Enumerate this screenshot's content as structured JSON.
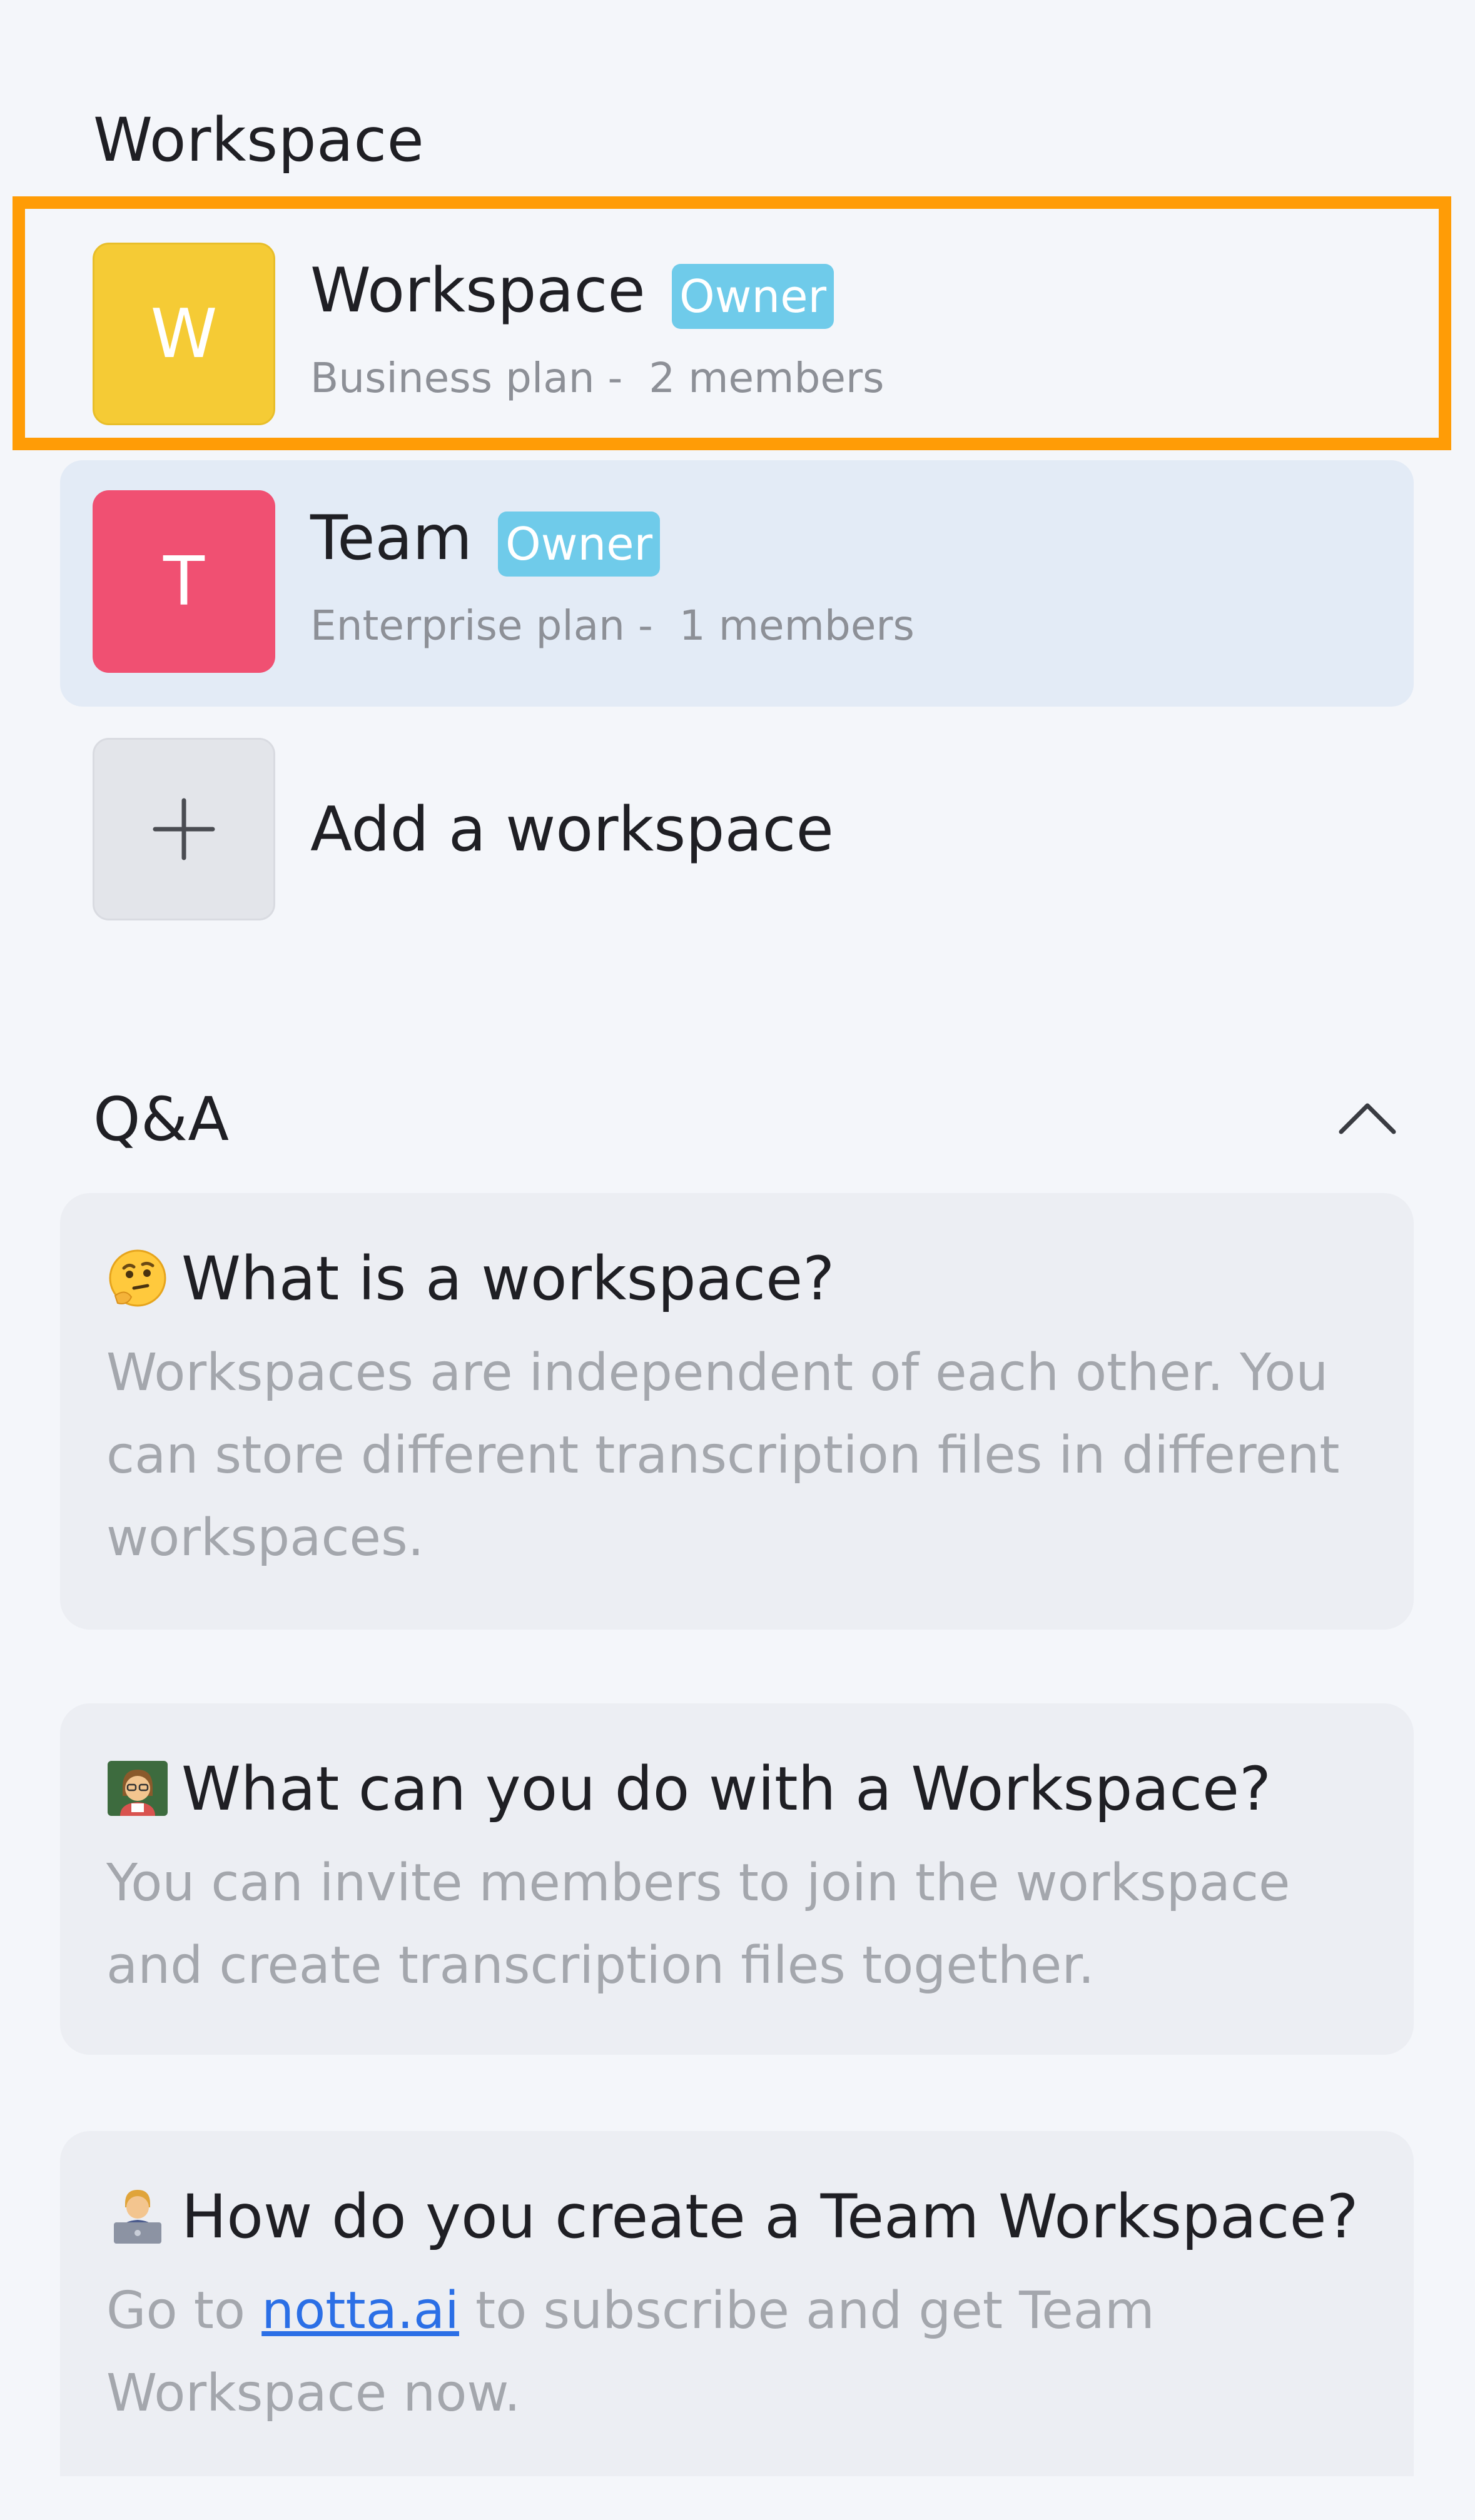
{
  "workspace_section": {
    "title": "Workspace",
    "items": [
      {
        "initial": "W",
        "name": "Workspace",
        "role": "Owner",
        "plan": "Business plan -",
        "members": "2 members",
        "avatar_color": "#F5CB35",
        "highlighted": true
      },
      {
        "initial": "T",
        "name": "Team",
        "role": "Owner",
        "plan": "Enterprise plan -",
        "members": "1 members",
        "avatar_color": "#F05072",
        "selected": true
      }
    ],
    "add_label": "Add a workspace"
  },
  "qa_section": {
    "title": "Q&A",
    "expanded": true,
    "items": [
      {
        "icon": "thinking-face-icon",
        "question": "What is a workspace?",
        "answer": "Workspaces are independent of each other. You can store different transcription files in different workspaces."
      },
      {
        "icon": "teacher-icon",
        "question": "What can you do with a Workspace?",
        "answer": "You can invite members to join the workspace and create transcription files together."
      },
      {
        "icon": "technologist-icon",
        "question": "How do you create a Team Workspace?",
        "answer_prefix": "Go to ",
        "answer_link": "notta.ai",
        "answer_suffix": " to subscribe and get Team Workspace now."
      }
    ]
  },
  "colors": {
    "background": "#F4F6FA",
    "highlight": "#FF9C06",
    "badge": "#6FCBEA",
    "selected_row": "#E3EBF6",
    "link": "#2B6FE6"
  }
}
